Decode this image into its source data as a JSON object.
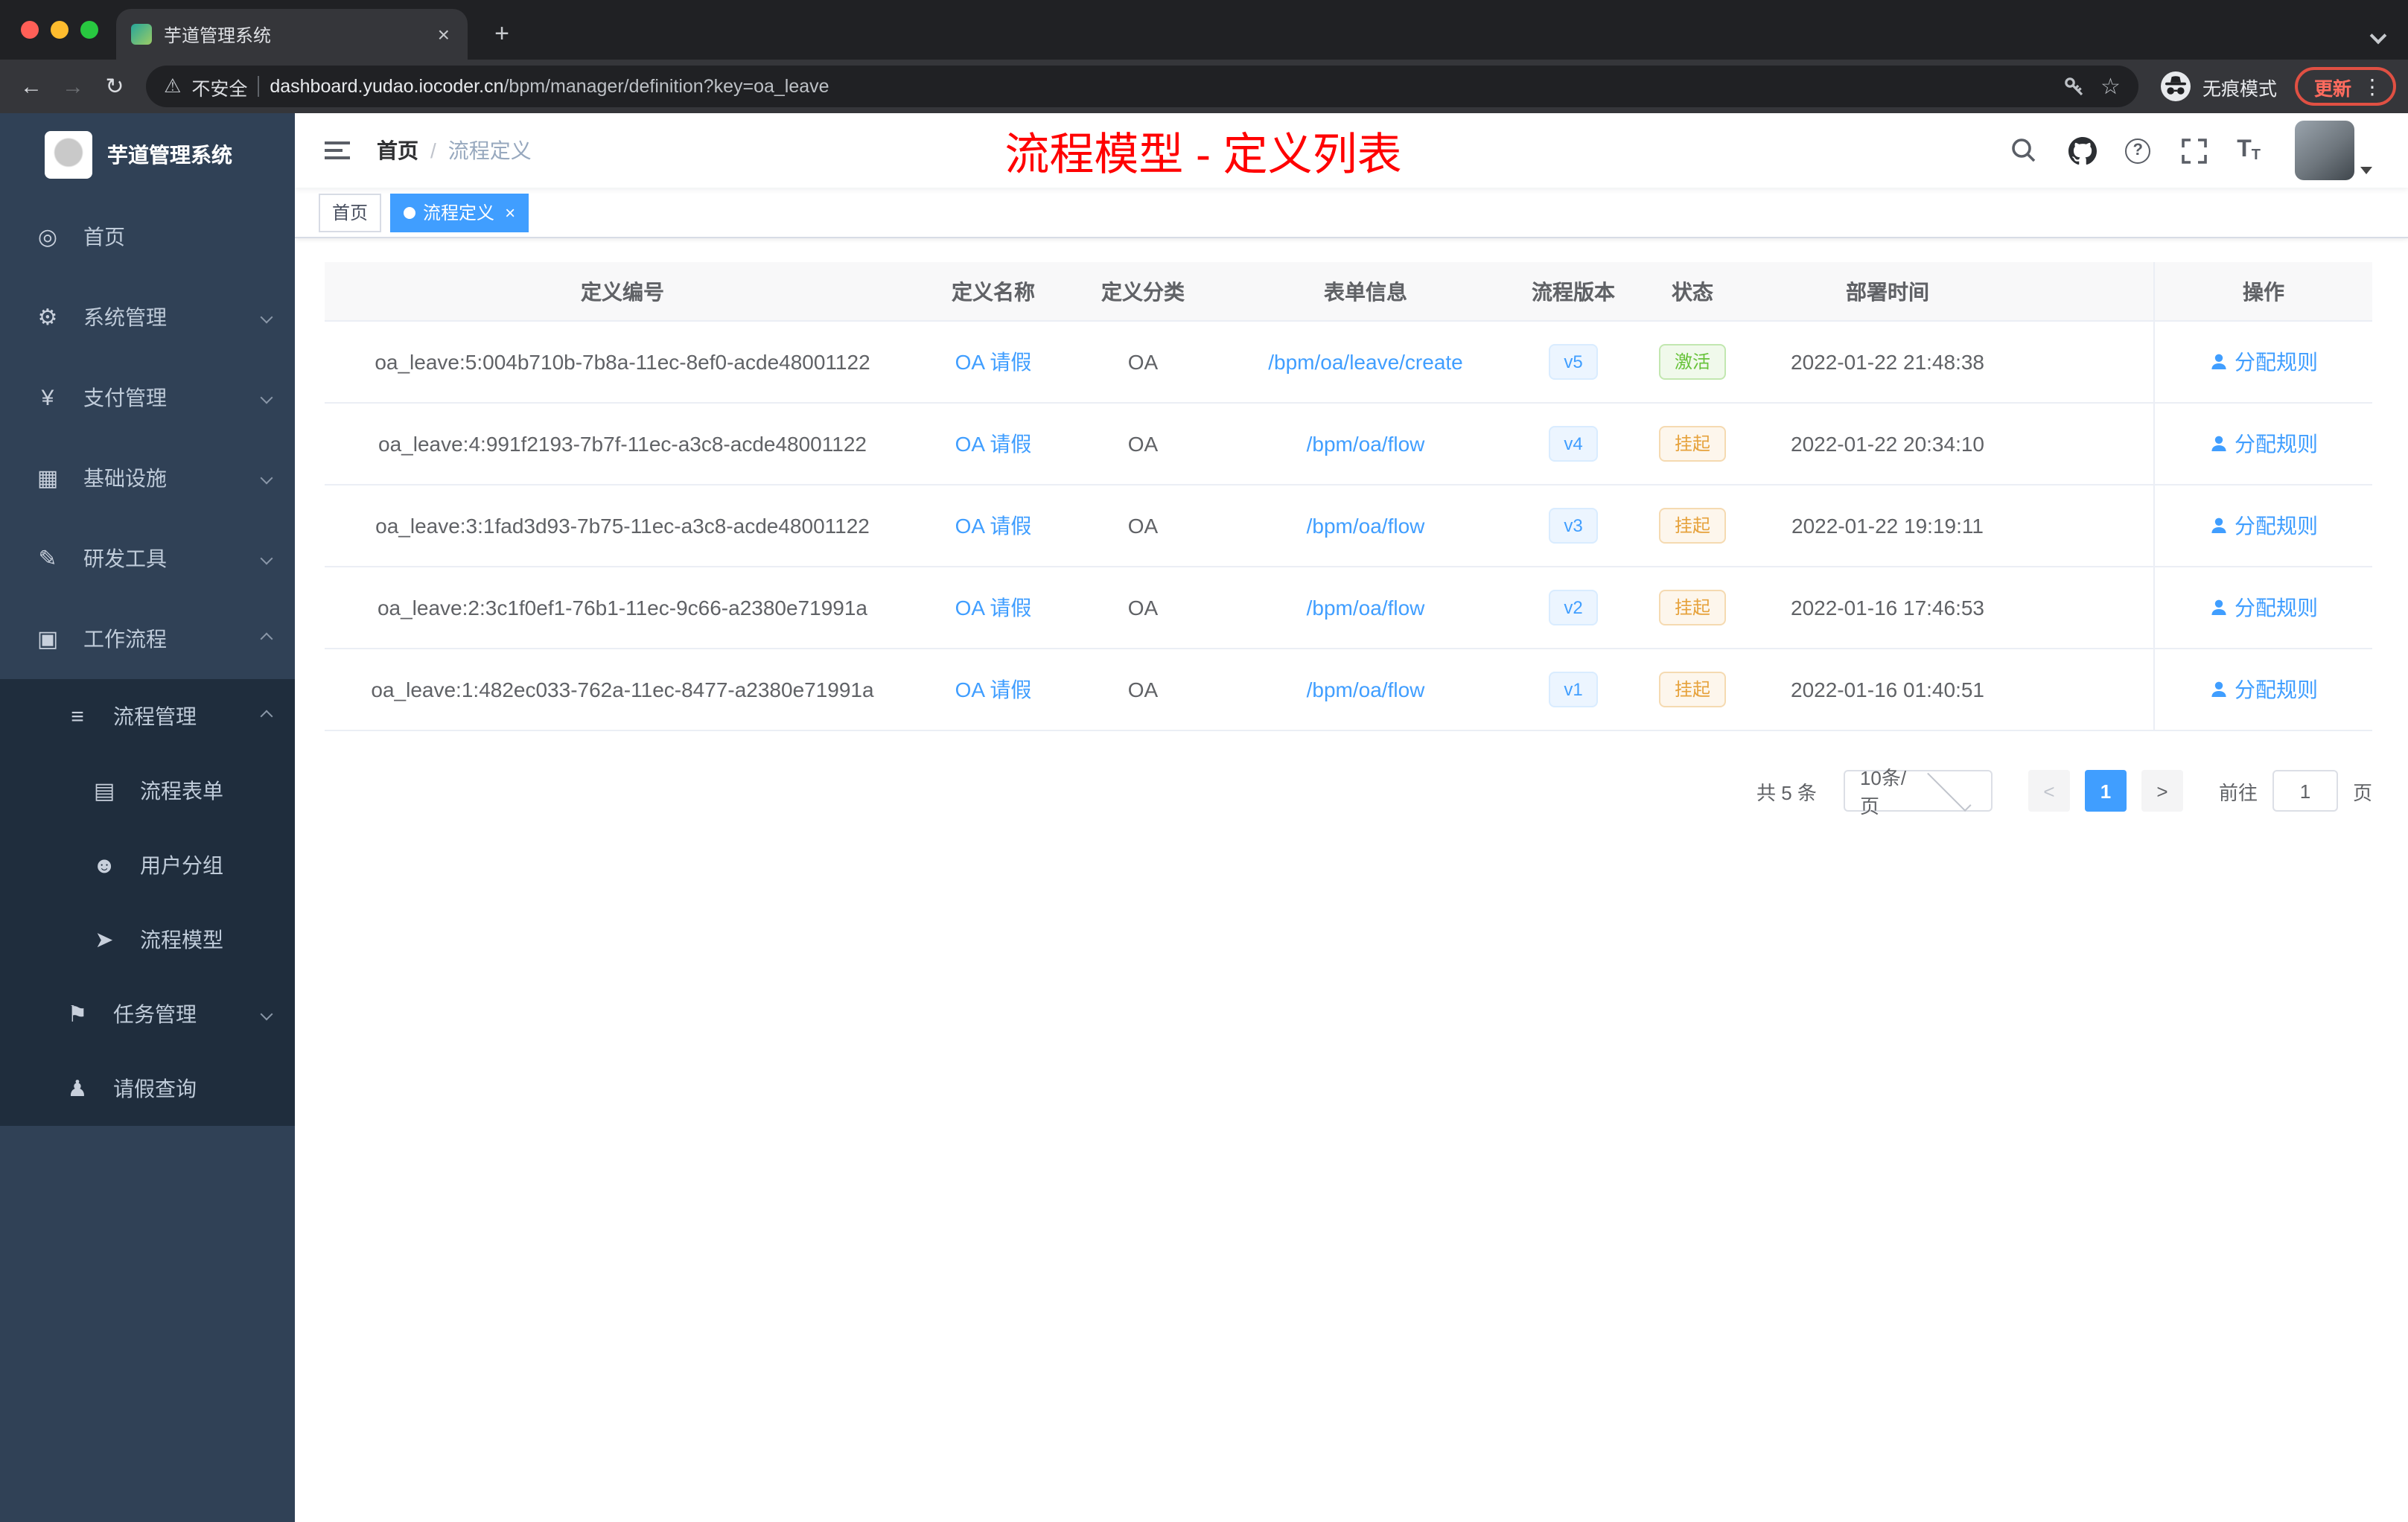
{
  "colors": {
    "accent": "#409eff",
    "title_red": "#ff0000",
    "success": "#67c23a",
    "warning": "#e6a23c",
    "sidebar_bg": "#304156",
    "submenu_bg": "#1f2d3d",
    "chrome_dark": "#202124"
  },
  "icons": {
    "dashboard": "◎",
    "system": "⚙",
    "payment": "¥",
    "infrastructure": "▦",
    "devtools": "✎",
    "workflow": "▣",
    "process_mgmt": "≡",
    "process_form": "▤",
    "user_group": "☻",
    "process_model": "➤",
    "task_mgmt": "⚑",
    "leave_query": "♟",
    "back": "←",
    "forward": "→",
    "reload": "↻",
    "warning_triangle": "⚠",
    "star": "☆",
    "kebab": "⋮",
    "plus": "+",
    "close": "×"
  },
  "browser": {
    "tab_title": "芋道管理系统",
    "security_label": "不安全",
    "url_domain": "dashboard.yudao.iocoder.cn",
    "url_path": "/bpm/manager/definition?key=oa_leave",
    "incognito_label": "无痕模式",
    "update_label": "更新"
  },
  "sidebar": {
    "logo_title": "芋道管理系统",
    "items": [
      {
        "label": "首页"
      },
      {
        "label": "系统管理"
      },
      {
        "label": "支付管理"
      },
      {
        "label": "基础设施"
      },
      {
        "label": "研发工具"
      },
      {
        "label": "工作流程"
      },
      {
        "label": "流程管理"
      },
      {
        "label": "流程表单"
      },
      {
        "label": "用户分组"
      },
      {
        "label": "流程模型"
      },
      {
        "label": "任务管理"
      },
      {
        "label": "请假查询"
      }
    ]
  },
  "header": {
    "breadcrumb_home": "首页",
    "breadcrumb_sep": "/",
    "breadcrumb_current": "流程定义",
    "page_title": "流程模型 - 定义列表"
  },
  "tags": [
    {
      "label": "首页"
    },
    {
      "label": "流程定义"
    }
  ],
  "table": {
    "columns": [
      "定义编号",
      "定义名称",
      "定义分类",
      "表单信息",
      "流程版本",
      "状态",
      "部署时间",
      "操作"
    ],
    "rows": [
      {
        "id": "oa_leave:5:004b710b-7b8a-11ec-8ef0-acde48001122",
        "name": "OA 请假",
        "category": "OA",
        "form": "/bpm/oa/leave/create",
        "version": "v5",
        "status": "激活",
        "status_type": "success",
        "deploy_time": "2022-01-22 21:48:38",
        "action": "分配规则"
      },
      {
        "id": "oa_leave:4:991f2193-7b7f-11ec-a3c8-acde48001122",
        "name": "OA 请假",
        "category": "OA",
        "form": "/bpm/oa/flow",
        "version": "v4",
        "status": "挂起",
        "status_type": "warning",
        "deploy_time": "2022-01-22 20:34:10",
        "action": "分配规则"
      },
      {
        "id": "oa_leave:3:1fad3d93-7b75-11ec-a3c8-acde48001122",
        "name": "OA 请假",
        "category": "OA",
        "form": "/bpm/oa/flow",
        "version": "v3",
        "status": "挂起",
        "status_type": "warning",
        "deploy_time": "2022-01-22 19:19:11",
        "action": "分配规则"
      },
      {
        "id": "oa_leave:2:3c1f0ef1-76b1-11ec-9c66-a2380e71991a",
        "name": "OA 请假",
        "category": "OA",
        "form": "/bpm/oa/flow",
        "version": "v2",
        "status": "挂起",
        "status_type": "warning",
        "deploy_time": "2022-01-16 17:46:53",
        "action": "分配规则"
      },
      {
        "id": "oa_leave:1:482ec033-762a-11ec-8477-a2380e71991a",
        "name": "OA 请假",
        "category": "OA",
        "form": "/bpm/oa/flow",
        "version": "v1",
        "status": "挂起",
        "status_type": "warning",
        "deploy_time": "2022-01-16 01:40:51",
        "action": "分配规则"
      }
    ]
  },
  "pagination": {
    "total": "共 5 条",
    "page_size": "10条/页",
    "current_page": "1",
    "goto_label": "前往",
    "goto_value": "1",
    "page_unit": "页"
  }
}
